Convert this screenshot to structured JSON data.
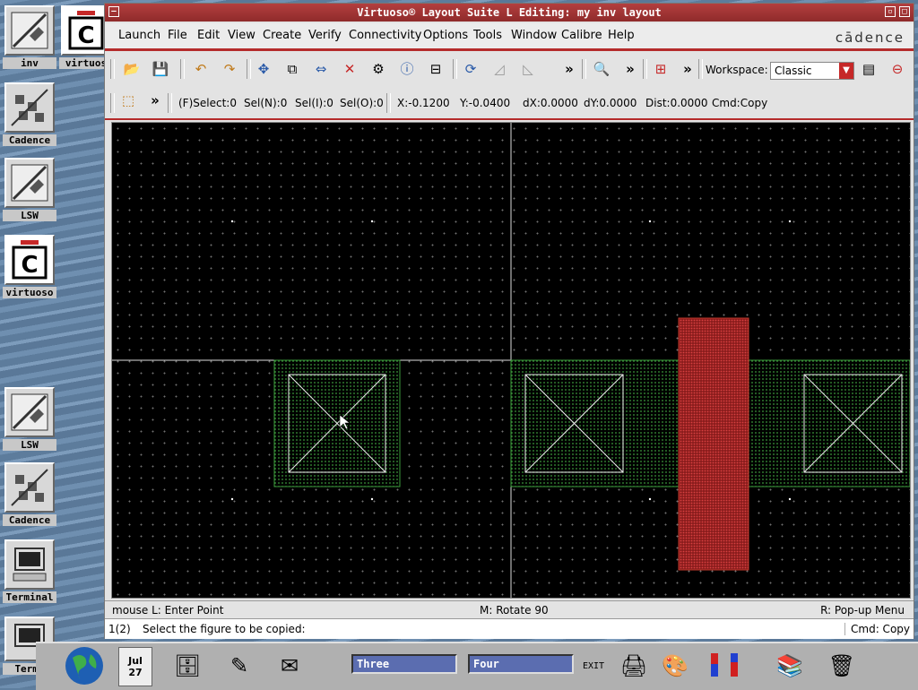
{
  "desktop_icons": [
    {
      "label": "inv"
    },
    {
      "label": "virtuos"
    },
    {
      "label": "Cadence"
    },
    {
      "label": "LSW"
    },
    {
      "label": "virtuoso"
    },
    {
      "label": "LSW"
    },
    {
      "label": "Cadence"
    },
    {
      "label": "Terminal"
    },
    {
      "label": "Termi"
    }
  ],
  "window": {
    "title": "Virtuoso® Layout Suite L Editing: my inv layout",
    "brand": "cādence"
  },
  "menu": [
    "Launch",
    "File",
    "Edit",
    "View",
    "Create",
    "Verify",
    "Connectivity",
    "Options",
    "Tools",
    "Window",
    "Calibre",
    "Help"
  ],
  "toolbar": {
    "workspace_label": "Workspace:",
    "workspace_value": "Classic",
    "more": "»"
  },
  "status": {
    "select": "(F)Select:0",
    "sel_n": "Sel(N):0",
    "sel_i": "Sel(I):0",
    "sel_o": "Sel(O):0",
    "x": "X:-0.1200",
    "y": "Y:-0.0400",
    "dx": "dX:0.0000",
    "dy": "dY:0.0000",
    "dist": "Dist:0.0000",
    "cmd": "Cmd:Copy"
  },
  "mouse_bar": {
    "left": "mouse L: Enter Point",
    "middle": "M: Rotate 90",
    "right": "R: Pop-up Menu"
  },
  "prompt_bar": {
    "index": "1(2)",
    "message": "Select the figure to be copied:",
    "cmd": "Cmd: Copy"
  },
  "taskbar": {
    "date_month": "Jul",
    "date_day": "27",
    "desk_three": "Three",
    "desk_four": "Four",
    "exit": "EXIT"
  },
  "colors": {
    "title_bar": "#9b3333",
    "accent_red": "#b52b2b",
    "poly": "#c0392b",
    "active": "#3a8a3a"
  }
}
